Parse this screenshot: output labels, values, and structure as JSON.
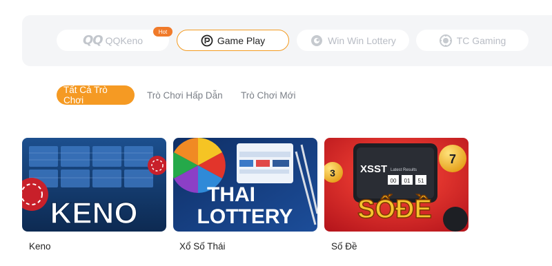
{
  "providers": [
    {
      "label": "QQKeno",
      "logo_text": "QQ",
      "icon": "qq-logo-icon",
      "active": false
    },
    {
      "label": "Game Play",
      "icon": "gameplay-logo-icon",
      "active": true
    },
    {
      "label": "Win Win Lottery",
      "icon": "winwin-logo-icon",
      "active": false
    },
    {
      "label": "TC Gaming",
      "icon": "tc-gaming-logo-icon",
      "active": false
    }
  ],
  "hot_badge": "Hot",
  "tabs": [
    {
      "label": "Tất Cả Trò Chơi",
      "active": true
    },
    {
      "label": "Trò Chơi Hấp Dẫn",
      "active": false
    },
    {
      "label": "Trò Chơi Mới",
      "active": false
    }
  ],
  "games": [
    {
      "name": "Keno",
      "thumb_text": "KENO"
    },
    {
      "name": "Xổ Số Thái",
      "thumb_text_1": "THAI",
      "thumb_text_2": "LOTTERY"
    },
    {
      "name": "Số Đề",
      "thumb_text": "SỐĐỀ",
      "screen_text": "XSST",
      "results_label": "Latest Results",
      "numbers": [
        "00",
        "01",
        "51"
      ],
      "ball_numbers": [
        "3",
        "7"
      ]
    }
  ],
  "colors": {
    "accent": "#f59a23",
    "hot": "#f07a2a",
    "provider_bg": "#f4f5f7"
  }
}
